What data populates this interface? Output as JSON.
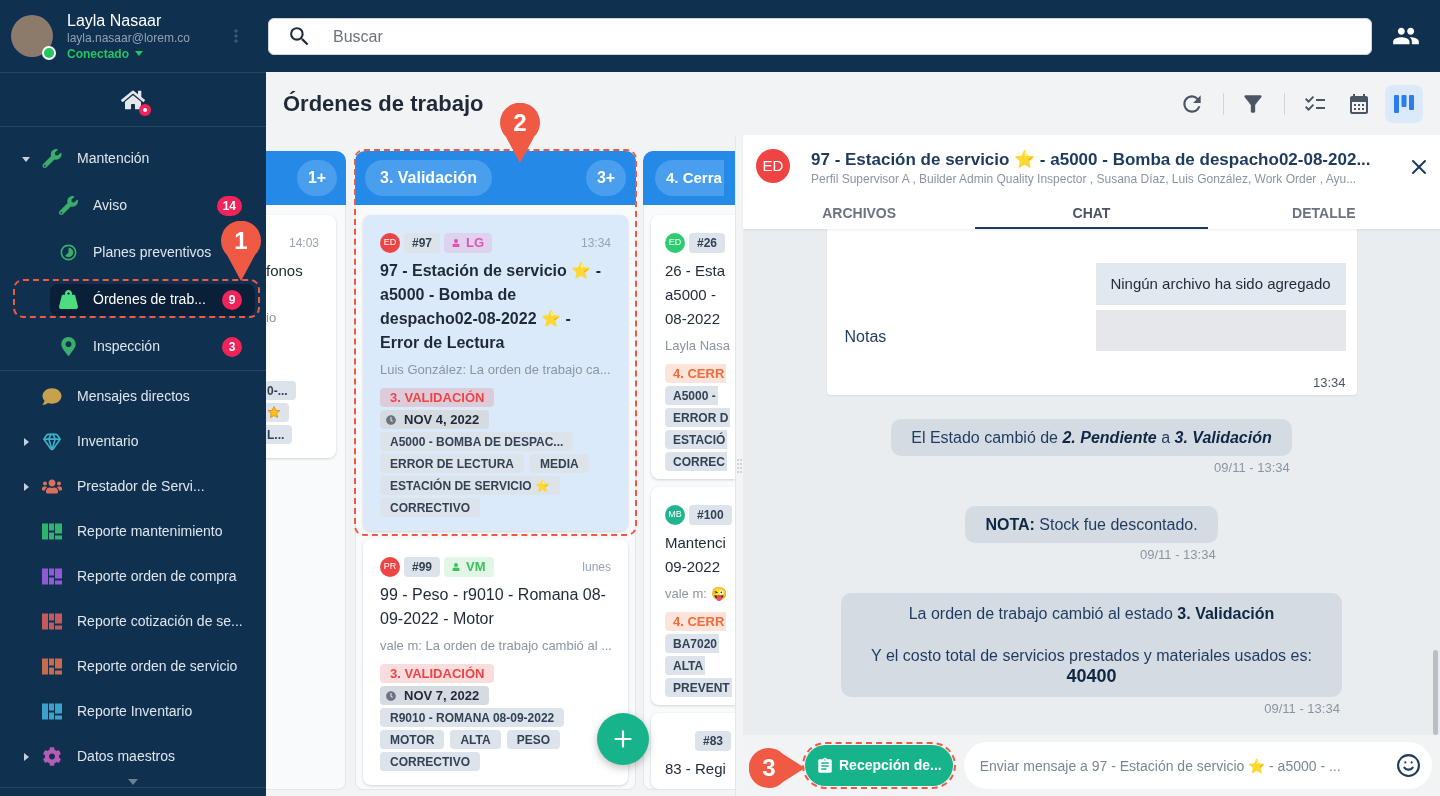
{
  "user": {
    "name": "Layla Nasaar",
    "email": "layla.nasaar@lorem.co",
    "status": "Conectado",
    "online": true
  },
  "search": {
    "placeholder": "Buscar"
  },
  "home": {
    "notification": true
  },
  "sidebar": {
    "items": [
      {
        "label": "Mantención",
        "color": "#3cae6b",
        "expanded": true,
        "selected": false,
        "children": [
          {
            "label": "Aviso",
            "badge": "14",
            "selected": false
          },
          {
            "label": "Planes preventivos",
            "selected": false
          },
          {
            "label": "Órdenes de trab...",
            "badge": "9",
            "selected": true
          },
          {
            "label": "Inspección",
            "badge": "3",
            "selected": false
          }
        ]
      },
      {
        "label": "Mensajes directos",
        "color": "#c9a04e",
        "selected": false
      },
      {
        "label": "Inventario",
        "color": "#3cb3c9",
        "expanded": false,
        "selected": false
      },
      {
        "label": "Prestador de Servi...",
        "color": "#d9705a",
        "expanded": false,
        "selected": false
      },
      {
        "label": "Reporte mantenimiento",
        "color": "#2fb46e",
        "selected": false
      },
      {
        "label": "Reporte orden de compra",
        "color": "#9159d6",
        "selected": false
      },
      {
        "label": "Reporte cotización de se...",
        "color": "#c8585a",
        "selected": false
      },
      {
        "label": "Reporte orden de servicio",
        "color": "#c96a4a",
        "selected": false
      },
      {
        "label": "Reporte Inventario",
        "color": "#3ba3c9",
        "selected": false
      },
      {
        "label": "Datos maestros",
        "color": "#b65bb6",
        "expanded": false,
        "selected": false
      }
    ]
  },
  "page": {
    "title": "Órdenes de trabajo",
    "views": [
      {
        "selected": false
      },
      {
        "selected": false
      },
      {
        "selected": true
      }
    ]
  },
  "board": {
    "columns": [
      {
        "count": "1+",
        "cards": [
          {
            "selected": false,
            "time": "14:03",
            "title_lines": [
              "fonos"
            ],
            "preview": "io",
            "tags": [
              {
                "kind": "text",
                "label": "0-..."
              },
              {
                "kind": "star"
              },
              {
                "kind": "text",
                "label": "L..."
              }
            ]
          }
        ]
      },
      {
        "title": "3. Validación",
        "count": "3+",
        "cards": [
          {
            "selected": true,
            "avatar": {
              "initials": "ED",
              "color": "#ef4444"
            },
            "number": "#97",
            "assignee": {
              "initials": "LG",
              "color": "#e94fae"
            },
            "time": "13:34",
            "title": "97 - Estación de servicio ⭐ - a5000 - Bomba de despacho02-08-2022 ⭐ - Error de Lectura",
            "preview": "Luis González: La orden de trabajo ca...",
            "status": {
              "label": "3. VALIDACIÓN",
              "color": "#ef4444"
            },
            "date": "NOV 4, 2022",
            "tags": [
              {
                "kind": "text",
                "label": "A5000 - BOMBA DE DESPAC..."
              },
              {
                "kind": "text",
                "label": "ERROR DE LECTURA"
              },
              {
                "kind": "text",
                "label": "MEDIA"
              },
              {
                "kind": "text",
                "label": "ESTACIÓN DE SERVICIO ⭐"
              },
              {
                "kind": "text",
                "label": "CORRECTIVO"
              }
            ]
          },
          {
            "selected": false,
            "avatar": {
              "initials": "PR",
              "color": "#ef4444"
            },
            "number": "#99",
            "assignee": {
              "initials": "VM",
              "color": "#3cc15b"
            },
            "time": "lunes",
            "title": "99 - Peso - r9010 - Romana 08-09-2022 - Motor",
            "preview": "vale m: La orden de trabajo cambió al ...",
            "status": {
              "label": "3. VALIDACIÓN",
              "color": "#ef4444"
            },
            "date": "NOV 7, 2022",
            "tags": [
              {
                "kind": "text",
                "label": "R9010 - ROMANA 08-09-2022"
              },
              {
                "kind": "text",
                "label": "MOTOR"
              },
              {
                "kind": "text",
                "label": "ALTA"
              },
              {
                "kind": "text",
                "label": "PESO"
              },
              {
                "kind": "text",
                "label": "CORRECTIVO"
              }
            ]
          }
        ]
      },
      {
        "title": "4. Cerra",
        "cards": [
          {
            "selected": false,
            "avatar": {
              "initials": "ED",
              "color": "#2ecc71"
            },
            "number": "#26",
            "title_lines": [
              "26 - Esta",
              "a5000 -",
              "08-2022"
            ],
            "preview": "Layla Nasa",
            "status": {
              "label": "4. CERR",
              "color": "#f26b3a"
            },
            "tags": [
              {
                "kind": "text",
                "label": "A5000 -"
              },
              {
                "kind": "text",
                "label": "ERROR D"
              },
              {
                "kind": "text",
                "label": "ESTACIÓ"
              },
              {
                "kind": "text",
                "label": "CORREC"
              }
            ]
          },
          {
            "selected": false,
            "avatar": {
              "initials": "MB",
              "color": "#1fb58f"
            },
            "number": "#100",
            "title_lines": [
              "Mantenci",
              "09-2022"
            ],
            "preview": "vale m: 😜",
            "status": {
              "label": "4. CERR",
              "color": "#f26b3a"
            },
            "tags": [
              {
                "kind": "text",
                "label": "BA7020"
              },
              {
                "kind": "text",
                "label": "ALTA"
              },
              {
                "kind": "text",
                "label": "PREVENT"
              }
            ]
          },
          {
            "selected": false,
            "number": "#83",
            "title_lines": [
              "83 - Regi"
            ]
          }
        ]
      }
    ]
  },
  "chat": {
    "avatar": {
      "initials": "ED",
      "color": "#ef4444"
    },
    "title": "97 - Estación de servicio ⭐ - a5000 - Bomba de despacho02-08-202...",
    "subtitle": "Perfil Supervisor A , Builder Admin Quality Inspector , Susana Díaz, Luis González, Work Order , Ayu...",
    "tabs": [
      {
        "label": "ARCHIVOS",
        "selected": false
      },
      {
        "label": "CHAT",
        "selected": true
      },
      {
        "label": "DETALLE",
        "selected": false
      }
    ],
    "form": {
      "files": "Ningún archivo ha sido agregado",
      "notes_label": "Notas",
      "time": "13:34"
    },
    "messages": [
      {
        "kind": "state_change",
        "text": "El Estado cambió de **2. Pendiente** a **3. Validación**",
        "time": "09/11 - 13:34"
      },
      {
        "kind": "note",
        "text": "**NOTA:** Stock fue descontado.",
        "time": "09/11 - 13:34"
      },
      {
        "kind": "summary",
        "text": "La orden de trabajo cambió al estado **3. Validación**",
        "detail": "Y el costo total de servicios prestados y materiales usados es:",
        "amount": "40400",
        "time": "09/11 - 13:34"
      }
    ],
    "action": "Recepción de...",
    "composer": {
      "placeholder": "Enviar mensaje a 97 - Estación de servicio ⭐ - a5000 - ..."
    }
  },
  "callouts": [
    "1",
    "2",
    "3"
  ]
}
